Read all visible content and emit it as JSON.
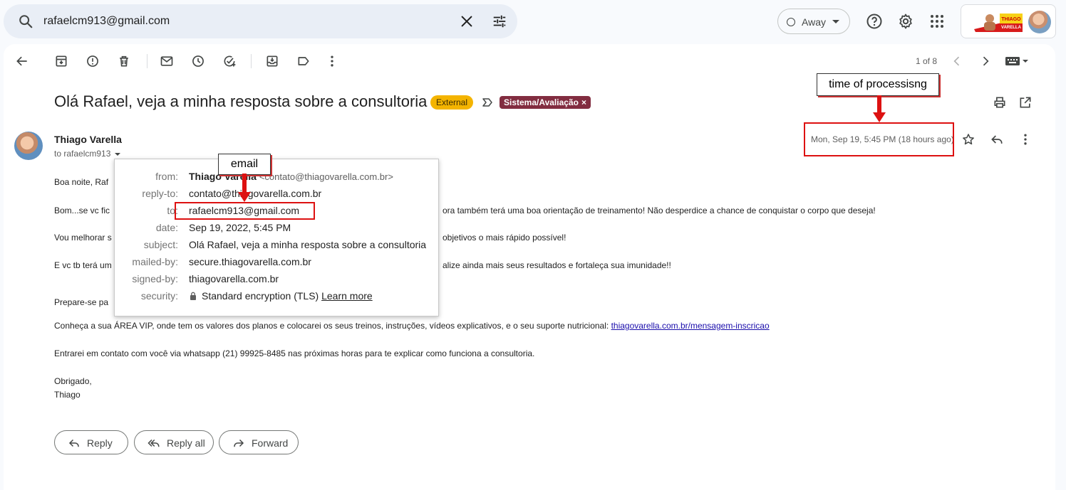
{
  "search": {
    "query": "rafaelcm913@gmail.com"
  },
  "status": {
    "label": "Away"
  },
  "brand": {
    "logo_text": "THIAGO VARELLA"
  },
  "toolbar": {
    "pager": "1 of 8"
  },
  "email": {
    "subject": "Olá Rafael, veja a minha resposta sobre a consultoria",
    "external_badge": "External",
    "label": "Sistema/Avaliação",
    "label_close": "×",
    "sender": "Thiago Varella",
    "to_line": "to rafaelcm913",
    "date": "Mon, Sep 19, 5:45 PM (18 hours ago)"
  },
  "details": {
    "from_label": "from:",
    "from_name": "Thiago Varella",
    "from_address": "<contato@thiagovarella.com.br>",
    "reply_to_label": "reply-to:",
    "reply_to": "contato@thiagovarella.com.br",
    "to_label": "to:",
    "to": "rafaelcm913@gmail.com",
    "date_label": "date:",
    "date": "Sep 19, 2022, 5:45 PM",
    "subject_label": "subject:",
    "subject": "Olá Rafael, veja a minha resposta sobre a consultoria",
    "mailed_by_label": "mailed-by:",
    "mailed_by": "secure.thiagovarella.com.br",
    "signed_by_label": "signed-by:",
    "signed_by": "thiagovarella.com.br",
    "security_label": "security:",
    "security": "Standard encryption (TLS)",
    "learn_more": "Learn more"
  },
  "body": {
    "greeting": "Boa noite, Raf",
    "p1_start": "Bom...se vc fic",
    "p1_end": "ora também terá uma boa orientação de treinamento! Não desperdice a chance de conquistar o corpo que deseja!",
    "p2_start": "Vou melhorar s",
    "p2_end": "objetivos o mais rápido possível!",
    "p3_start": "E vc tb terá um",
    "p3_end": "alize ainda mais seus resultados e fortaleça sua imunidade!!",
    "p4_start": "Prepare-se pa",
    "p5": "Conheça a sua ÁREA VIP, onde tem os valores dos planos e colocarei os seus treinos, instruções, vídeos explicativos, e o seu suporte nutricional:",
    "p5_link": "thiagovarella.com.br/mensagem-inscricao",
    "p6": "Entrarei em contato com você via whatsapp (21) 99925-8485 nas próximas horas para te explicar como funciona a consultoria.",
    "closing": "Obrigado,",
    "signature": "Thiago"
  },
  "actions": {
    "reply": "Reply",
    "reply_all": "Reply all",
    "forward": "Forward"
  },
  "annotations": {
    "time_note": "time of processisng",
    "email_note": "email"
  },
  "colors": {
    "external": "#f4b400",
    "label": "#822d40",
    "annotation": "#dd1111"
  }
}
